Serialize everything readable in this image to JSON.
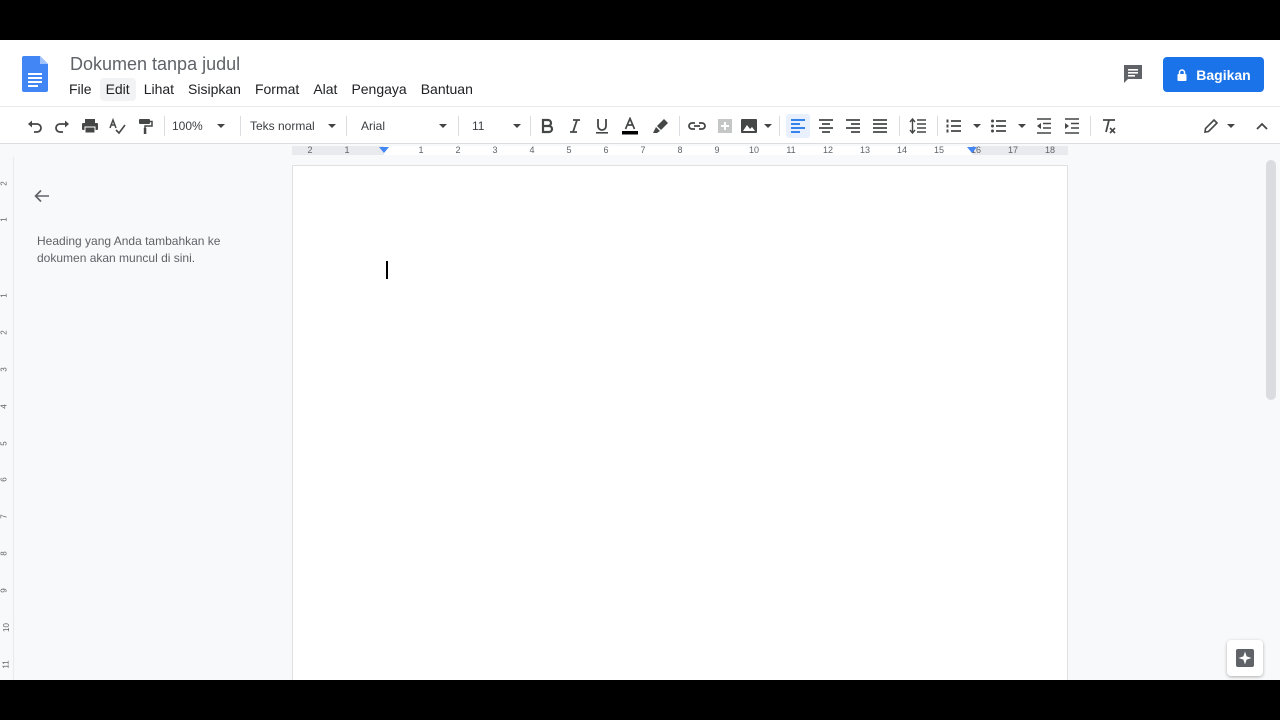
{
  "app": {
    "title": "Dokumen tanpa judul",
    "menu": [
      "File",
      "Edit",
      "Lihat",
      "Sisipkan",
      "Format",
      "Alat",
      "Pengaya",
      "Bantuan"
    ],
    "share_label": "Bagikan"
  },
  "toolbar": {
    "zoom": "100%",
    "style": "Teks normal",
    "font": "Arial",
    "size": "11"
  },
  "ruler": {
    "numbers": [
      "2",
      "1",
      "1",
      "2",
      "3",
      "4",
      "5",
      "6",
      "7",
      "8",
      "9",
      "10",
      "11",
      "12",
      "13",
      "14",
      "15",
      "16",
      "17",
      "18"
    ]
  },
  "vruler": {
    "numbers": [
      "2",
      "1",
      "1",
      "2",
      "3",
      "4",
      "5",
      "6",
      "7",
      "8",
      "9",
      "10",
      "11"
    ]
  },
  "outline": {
    "message": "Heading yang Anda tambahkan ke dokumen akan muncul di sini."
  },
  "colors": {
    "accent": "#1a73e8",
    "docs_blue": "#4285f4"
  }
}
